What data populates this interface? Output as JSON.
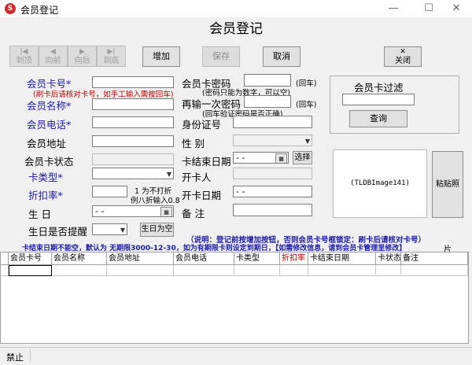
{
  "window": {
    "title": "会员登记",
    "minimize": "—",
    "maximize": "☐",
    "close": "✕"
  },
  "heading": "会员登记",
  "nav": [
    {
      "label": "到顶",
      "icon": "|◀"
    },
    {
      "label": "向前",
      "icon": "◀"
    },
    {
      "label": "向后",
      "icon": "▶"
    },
    {
      "label": "到底",
      "icon": "▶|"
    }
  ],
  "toolbar": {
    "add": "增加",
    "save": "保存",
    "cancel": "取消",
    "close_icon": "✕",
    "close": "关闭"
  },
  "left_form": {
    "card_no_label": "会员卡号*",
    "card_no_note": "(刷卡后请核对卡号，如手工输入需按回车)",
    "name_label": "会员名称*",
    "phone_label": "会员电话*",
    "address_label": "会员地址",
    "card_status_label": "会员卡状态",
    "card_type_label": "卡类型*",
    "discount_label": "折扣率*",
    "discount_note_1": "1 为不打折",
    "discount_note_2": "例八折输入0.8",
    "birthday_label": "生    日",
    "birthday_value": "-   -",
    "remind_label": "生日是否提醒",
    "birthday_empty_btn": "生日为空"
  },
  "right_form": {
    "password_label": "会员卡密码",
    "password_hint": "(回车)",
    "password_note": "(密码只能为数字，可以空)",
    "password2_label": "再输一次密码",
    "password2_hint": "(回车)",
    "password2_note": "(回车验证密码是否正确)",
    "id_label": "身份证号",
    "gender_label": "性    别",
    "card_end_label": "卡结束日期",
    "card_end_value": "-   -",
    "select_btn": "选择",
    "opener_label": "开卡人",
    "open_date_label": "开卡日期",
    "open_date_value": "-   -",
    "remark_label": "备    注"
  },
  "filter": {
    "title": "会员卡过滤",
    "query_btn": "查询"
  },
  "photo": {
    "placeholder": "(TLDBImage141)",
    "paste_btn": "粘贴照片"
  },
  "notes": {
    "line1": "（说明：登记前按增加按钮，否则会员卡号框锁定：刷卡后请核对卡号）",
    "line2": "卡结束日期不能空，默认为 无期限3000-12-30，如为有期限卡则设定到期日，【如需修改信息，请到会员卡管理里修改】"
  },
  "table": {
    "columns": [
      "会员卡号",
      "会员名称",
      "会员地址",
      "会员电话",
      "卡类型",
      "折扣率",
      "卡结束日期",
      "卡状态",
      "备注"
    ]
  },
  "status": {
    "text": "禁止"
  },
  "colors": {
    "label_blue": "#1a1aa8",
    "note_red": "#c00000"
  }
}
